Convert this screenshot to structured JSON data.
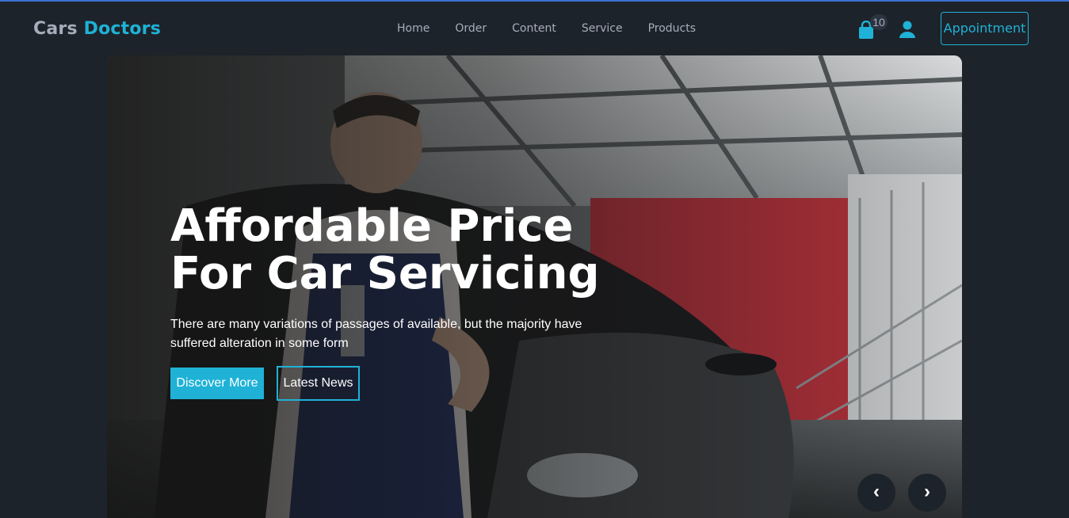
{
  "brand": {
    "part1": "Cars",
    "part2": "Doctors"
  },
  "nav": {
    "links": [
      "Home",
      "Order",
      "Content",
      "Service",
      "Products"
    ]
  },
  "header": {
    "cart_count": "10",
    "cart_icon": "shopping-bag-icon",
    "user_icon": "user-icon",
    "appointment_label": "Appointment"
  },
  "hero": {
    "title_line1": "Affordable Price",
    "title_line2": "For Car Servicing",
    "description": "There are many variations of passages of available, but the majority have suffered alteration in some form",
    "discover_label": "Discover More",
    "news_label": "Latest News",
    "prev_label": "‹",
    "next_label": "›"
  },
  "colors": {
    "background": "#1d232a",
    "accent": "#1fb2d6",
    "muted_text": "#a6adbb"
  }
}
